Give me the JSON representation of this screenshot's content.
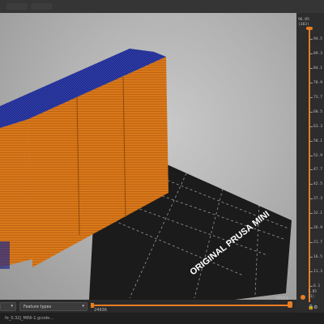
{
  "bed": {
    "label": "ORIGINAL PRUSA MINI"
  },
  "vertical_slider": {
    "top_value": "96.85",
    "top_layer": "(303)",
    "bottom_value": "1.85",
    "bottom_layer": "(1)",
    "ticks": [
      "94.5",
      "89.3",
      "84.1",
      "78.9",
      "73.7",
      "68.5",
      "63.3",
      "58.1",
      "52.9",
      "47.7",
      "42.5",
      "37.3",
      "32.1",
      "26.9",
      "21.7",
      "16.5",
      "11.3",
      "6.1"
    ],
    "accent_color": "#e87d22"
  },
  "horizontal_slider": {
    "left_value": "24936",
    "right_value": "25553"
  },
  "bottom_bar": {
    "view_type": "Feature types"
  },
  "status": {
    "filename": "fe_0.32J_MINI-1.gcode..."
  },
  "colors": {
    "model": "#d9781a",
    "top_infill": "#1f2a8c",
    "bed": "#1b1b1b",
    "accent": "#e87d22"
  }
}
